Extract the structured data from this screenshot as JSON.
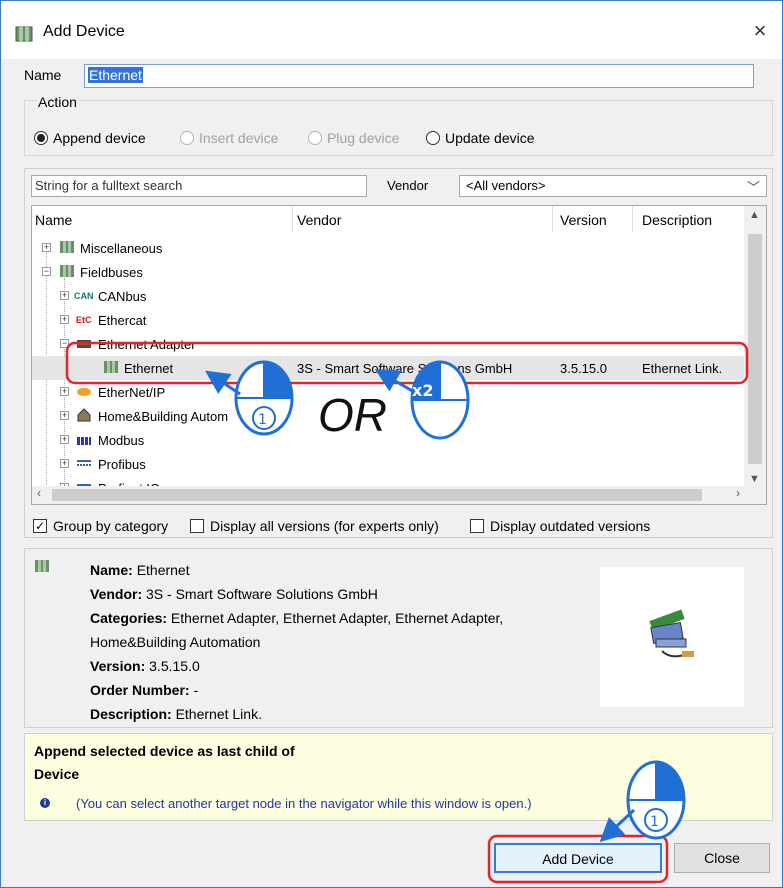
{
  "window": {
    "title": "Add Device",
    "close_glyph": "×"
  },
  "name_field": {
    "label": "Name",
    "value": "Ethernet"
  },
  "action": {
    "legend": "Action",
    "options": [
      {
        "label": "Append device",
        "selected": true,
        "enabled": true
      },
      {
        "label": "Insert device",
        "selected": false,
        "enabled": false
      },
      {
        "label": "Plug device",
        "selected": false,
        "enabled": false
      },
      {
        "label": "Update device",
        "selected": false,
        "enabled": true
      }
    ]
  },
  "search": {
    "placeholder": "String for a fulltext search",
    "vendor_label": "Vendor",
    "vendor_value": "<All vendors>"
  },
  "tree": {
    "columns": [
      "Name",
      "Vendor",
      "Version",
      "Description"
    ],
    "rows": [
      {
        "label": "Miscellaneous",
        "icon": "device-folder-icon"
      },
      {
        "label": "Fieldbuses",
        "icon": "device-folder-icon"
      },
      {
        "label": "CANbus",
        "icon": "can-icon"
      },
      {
        "label": "Ethercat",
        "icon": "ethercat-icon"
      },
      {
        "label": "Ethernet Adapter",
        "icon": "ethernet-adapter-icon"
      },
      {
        "label": "Ethernet",
        "icon": "device-folder-icon",
        "vendor": "3S - Smart Software Solutions GmbH",
        "version": "3.5.15.0",
        "description": "Ethernet Link."
      },
      {
        "label": "EtherNet/IP",
        "icon": "ethernetip-icon"
      },
      {
        "label": "Home&Building Autom",
        "icon": "home-icon"
      },
      {
        "label": "Modbus",
        "icon": "modbus-icon"
      },
      {
        "label": "Profibus",
        "icon": "profibus-icon"
      },
      {
        "label": "Profinet IO",
        "icon": "profinet-icon"
      }
    ]
  },
  "options": {
    "group_by_category": "Group by category",
    "display_all_versions": "Display all versions (for experts only)",
    "display_outdated": "Display outdated versions"
  },
  "info": {
    "name_key": "Name:",
    "name_val": "Ethernet",
    "vendor_key": "Vendor:",
    "vendor_val": "3S - Smart Software Solutions GmbH",
    "categories_key": "Categories:",
    "categories_val": "Ethernet Adapter, Ethernet Adapter, Ethernet Adapter,",
    "categories_val2": "Home&Building Automation",
    "version_key": "Version:",
    "version_val": "3.5.15.0",
    "order_key": "Order Number:",
    "order_val": "-",
    "desc_key": "Description:",
    "desc_val": "Ethernet Link."
  },
  "hint": {
    "line1": "Append selected device as last child of",
    "line2": "Device",
    "note": "(You can select another target node in the navigator while this window is open.)"
  },
  "buttons": {
    "add_device": "Add Device",
    "close": "Close"
  },
  "annotations": {
    "or_text": "OR",
    "step1": "①",
    "double_click": "x2",
    "highlight_color": "#e2242c",
    "arrow_color": "#1f6fd6"
  }
}
